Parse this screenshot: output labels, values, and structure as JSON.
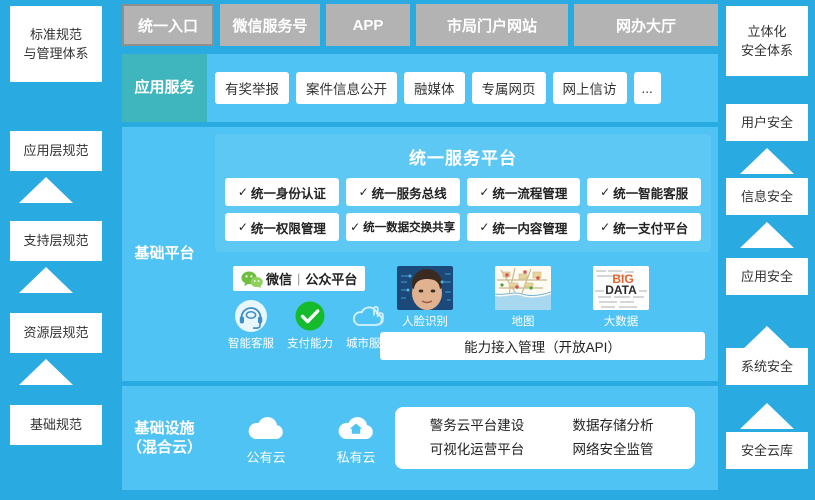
{
  "left_column": {
    "header": {
      "line1": "标准规范",
      "line2": "与管理体系"
    },
    "items": [
      {
        "label": "应用层规范"
      },
      {
        "label": "支持层规范"
      },
      {
        "label": "资源层规范"
      },
      {
        "label": "基础规范"
      }
    ]
  },
  "right_column": {
    "header": {
      "line1": "立体化",
      "line2": "安全体系"
    },
    "items": [
      {
        "label": "用户安全"
      },
      {
        "label": "信息安全"
      },
      {
        "label": "应用安全"
      },
      {
        "label": "系统安全"
      },
      {
        "label": "安全云库"
      }
    ]
  },
  "entry_row": {
    "items": [
      {
        "label": "统一入口",
        "primary": true
      },
      {
        "label": "微信服务号",
        "primary": false
      },
      {
        "label": "APP",
        "primary": false
      },
      {
        "label": "市局门户网站",
        "primary": false
      },
      {
        "label": "网办大厅",
        "primary": false
      }
    ]
  },
  "app_services": {
    "label": "应用服务",
    "items": [
      {
        "label": "有奖举报"
      },
      {
        "label": "案件信息公开"
      },
      {
        "label": "融媒体"
      },
      {
        "label": "专属网页"
      },
      {
        "label": "网上信访"
      },
      {
        "label": "..."
      }
    ]
  },
  "base_platform": {
    "label": "基础平台",
    "unified_service_platform": {
      "title": "统一服务平台",
      "check": "✓",
      "items": [
        {
          "label": "统一身份认证"
        },
        {
          "label": "统一服务总线"
        },
        {
          "label": "统一流程管理"
        },
        {
          "label": "统一智能客服"
        },
        {
          "label": "统一权限管理"
        },
        {
          "label": "统一数据交换共享"
        },
        {
          "label": "统一内容管理"
        },
        {
          "label": "统一支付平台"
        }
      ]
    },
    "capabilities": {
      "wechat_badge": {
        "brand": "微信",
        "separator": "|",
        "platform": "公众平台"
      },
      "icons": [
        {
          "label": "智能客服",
          "icon": "headset-icon"
        },
        {
          "label": "支付能力",
          "icon": "green-check-icon"
        },
        {
          "label": "城市服务",
          "icon": "cloud-touch-icon"
        }
      ],
      "thumbnails": [
        {
          "label": "人脸识别",
          "icon": "face-recognition-thumb"
        },
        {
          "label": "地图",
          "icon": "map-thumb"
        },
        {
          "label": "大数据",
          "icon": "big-data-thumb",
          "text1": "BIG",
          "text2": "DATA"
        }
      ],
      "api_bar": "能力接入管理（开放API）"
    }
  },
  "infrastructure": {
    "label_line1": "基础设施",
    "label_line2": "（混合云）",
    "clouds": [
      {
        "label": "公有云",
        "icon": "public-cloud-icon"
      },
      {
        "label": "私有云",
        "icon": "private-cloud-icon"
      }
    ],
    "card_items": [
      {
        "label": "警务云平台建设"
      },
      {
        "label": "数据存储分析"
      },
      {
        "label": "可视化运营平台"
      },
      {
        "label": "网络安全监管"
      }
    ]
  },
  "colors": {
    "background_blue": "#29abe2",
    "panel_blue": "#4fc3f3",
    "panel_blue_light": "#5ec8f4",
    "label_teal": "#3fb5bd",
    "gray_box": "#b3b3b3",
    "white": "#ffffff",
    "wechat_green": "#09bb07"
  }
}
